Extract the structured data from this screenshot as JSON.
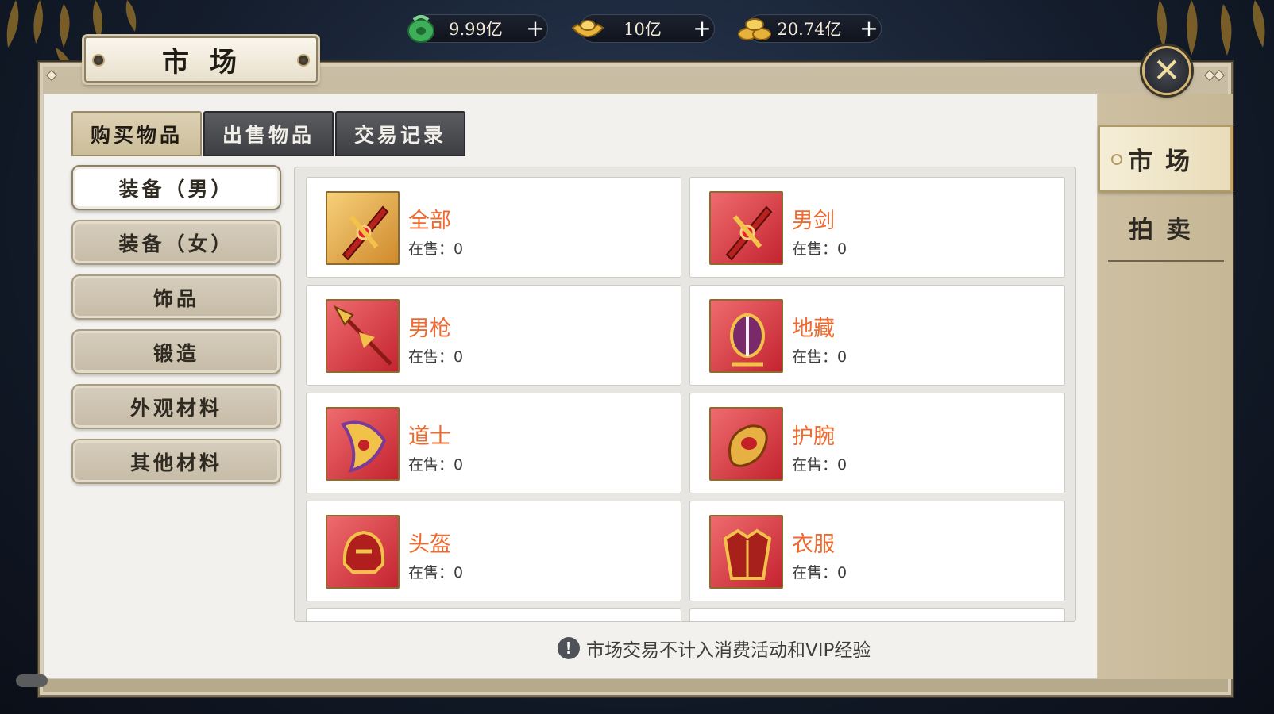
{
  "currencies": [
    {
      "icon": "jade-coin-icon",
      "value": "9.99亿",
      "plus": "+"
    },
    {
      "icon": "gold-ingot-icon",
      "value": "10亿",
      "plus": "+"
    },
    {
      "icon": "gold-coins-icon",
      "value": "20.74亿",
      "plus": "+"
    }
  ],
  "window": {
    "title": "市场",
    "close_icon": "close-icon"
  },
  "tabs": [
    {
      "label": "购买物品",
      "active": true
    },
    {
      "label": "出售物品",
      "active": false
    },
    {
      "label": "交易记录",
      "active": false
    }
  ],
  "categories": [
    {
      "label": "装备（男）",
      "active": true
    },
    {
      "label": "装备（女）",
      "active": false
    },
    {
      "label": "饰品",
      "active": false
    },
    {
      "label": "锻造",
      "active": false
    },
    {
      "label": "外观材料",
      "active": false
    },
    {
      "label": "其他材料",
      "active": false
    }
  ],
  "items": [
    {
      "name": "全部",
      "sale": "在售：0",
      "icon": "sword-icon",
      "bg": "gold"
    },
    {
      "name": "男剑",
      "sale": "在售：0",
      "icon": "sword-icon",
      "bg": "red"
    },
    {
      "name": "男枪",
      "sale": "在售：0",
      "icon": "spear-icon",
      "bg": "red"
    },
    {
      "name": "地藏",
      "sale": "在售：0",
      "icon": "ornate-staff-icon",
      "bg": "red"
    },
    {
      "name": "道士",
      "sale": "在售：0",
      "icon": "talisman-blade-icon",
      "bg": "red"
    },
    {
      "name": "护腕",
      "sale": "在售：0",
      "icon": "bracer-icon",
      "bg": "red"
    },
    {
      "name": "头盔",
      "sale": "在售：0",
      "icon": "helmet-icon",
      "bg": "red"
    },
    {
      "name": "衣服",
      "sale": "在售：0",
      "icon": "armor-icon",
      "bg": "red"
    }
  ],
  "side_tabs": [
    {
      "label": "市场",
      "active": true
    },
    {
      "label": "拍卖",
      "active": false
    }
  ],
  "notice": {
    "icon": "exclamation-icon",
    "text": "市场交易不计入消费活动和VIP经验"
  },
  "colors": {
    "item_name": "#ef6a2e",
    "frame": "#c9bda4",
    "active_tab": "#cbbd98"
  }
}
